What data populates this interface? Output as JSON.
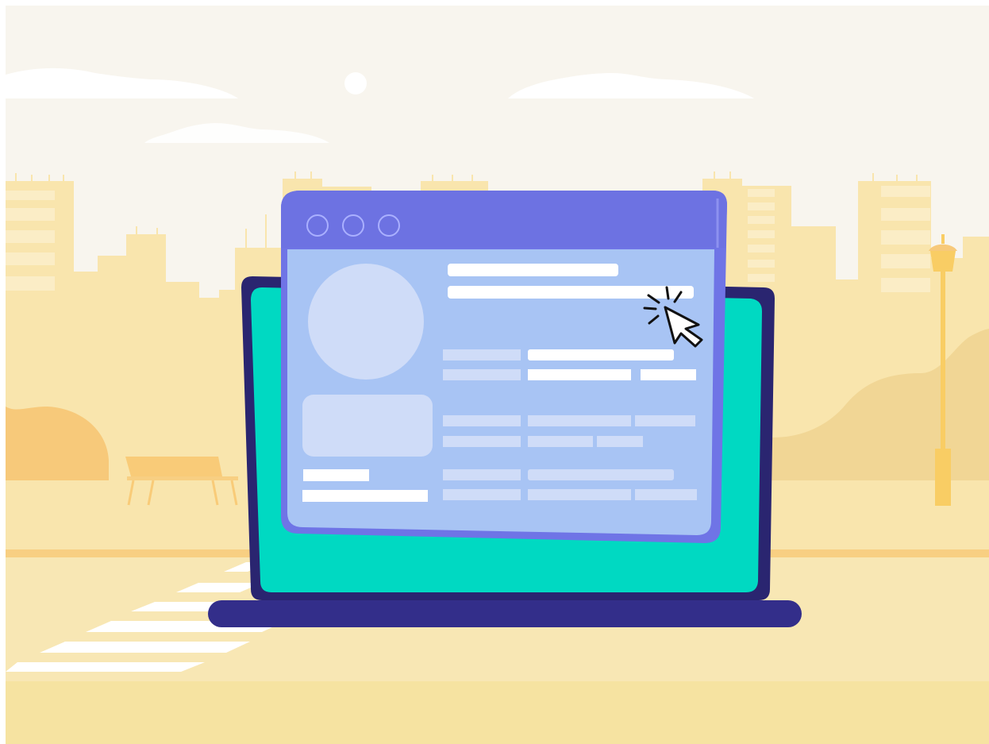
{
  "scene": {
    "subject": "illustration",
    "palette": {
      "sky": "#f8f5ee",
      "cloud": "#ffffff",
      "buildings": "#f9e5ad",
      "building_windows": "#fbedc6",
      "hills": "#f1d695",
      "bush": "#f7c97a",
      "ground": "#f8e7b4",
      "ground_lower": "#f6e3a1",
      "road_edge": "#f8cf82",
      "crosswalk": "#ffffff",
      "bench": "#f9cb78",
      "lamp": "#f9cd64",
      "laptop_frame": "#2a2570",
      "laptop_base": "#332e8a",
      "laptop_screen": "#00d9c2",
      "window_frame": "#6f74e6",
      "window_titlebar": "#6d72e2",
      "window_body": "#a8c4f4",
      "placeholder_light": "#cfdcf8",
      "placeholder_white": "#ffffff",
      "cursor": "#111111"
    },
    "icons": {
      "titlebar_controls": [
        "circle-outline-icon",
        "circle-outline-icon",
        "circle-outline-icon"
      ],
      "pointer": "mouse-pointer-click-icon"
    }
  }
}
